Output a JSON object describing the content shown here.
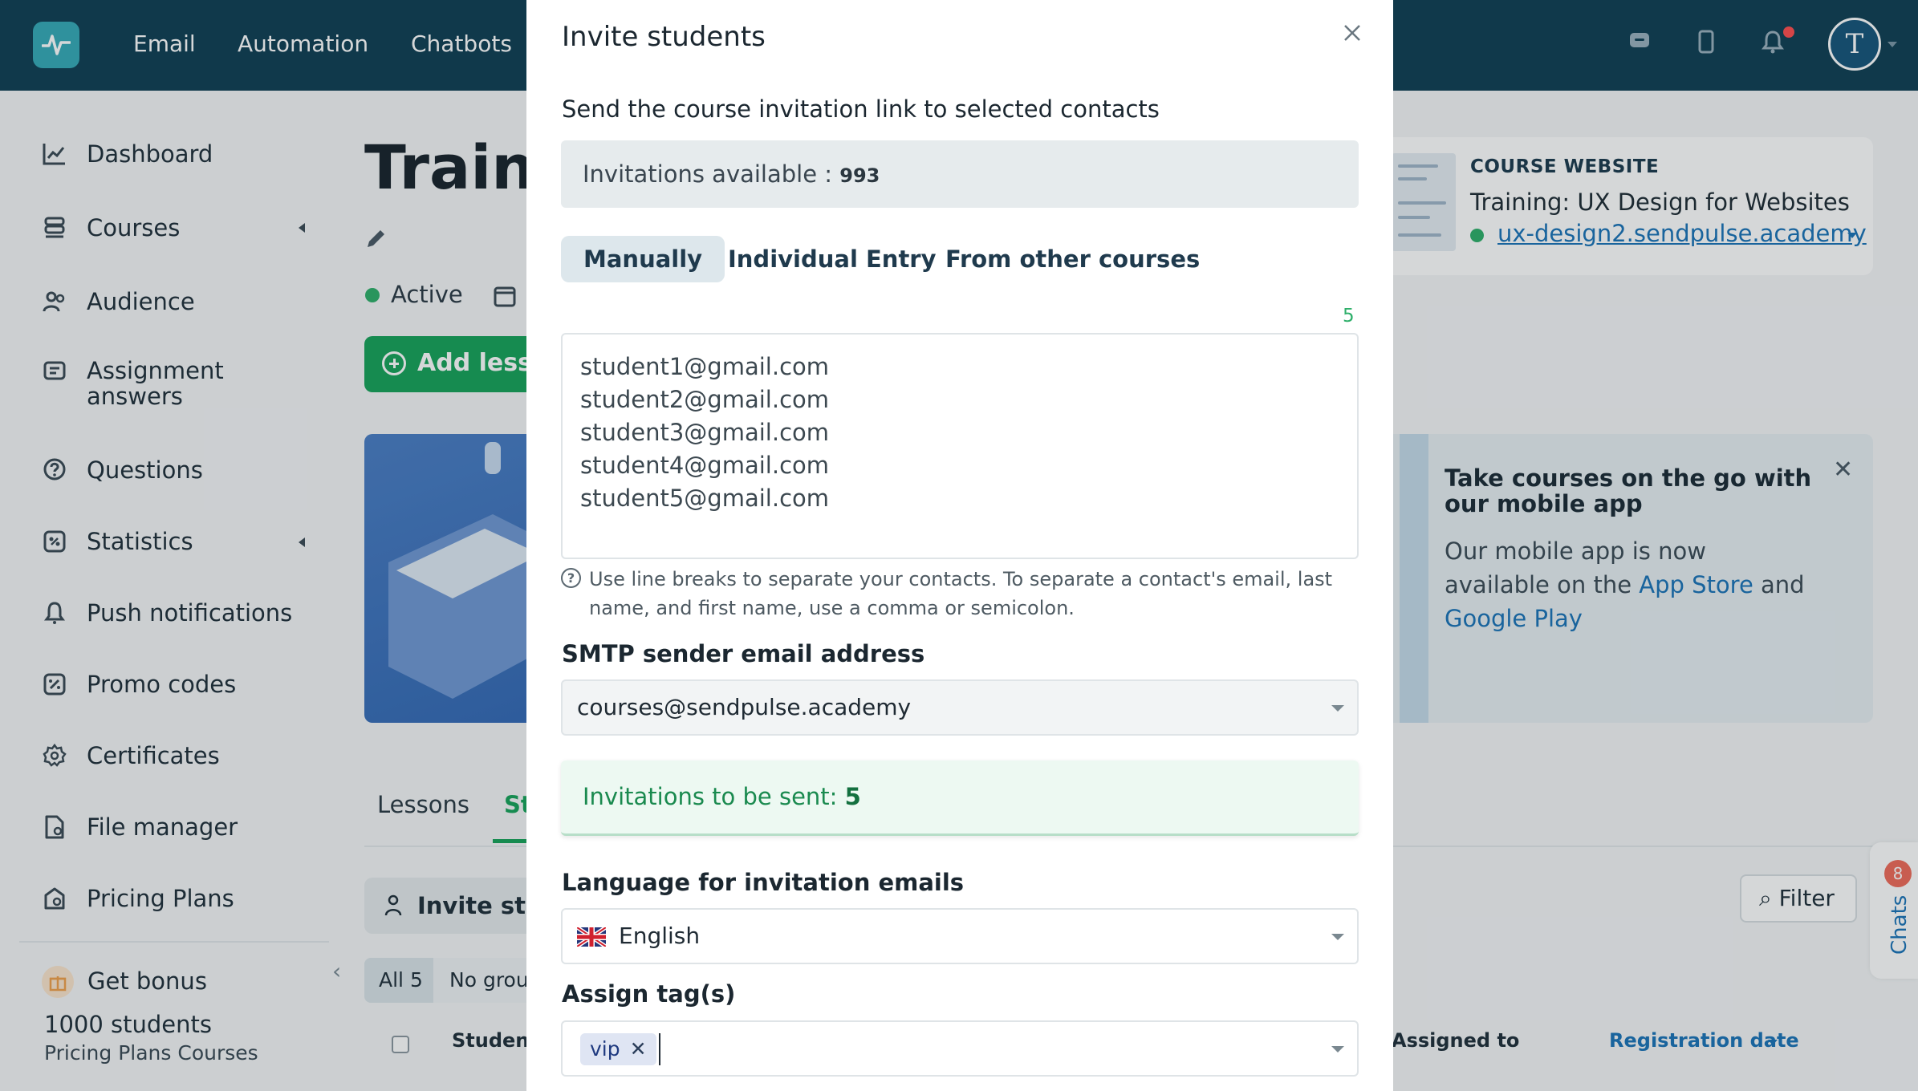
{
  "topnav": {
    "items": [
      "Email",
      "Automation",
      "Chatbots"
    ],
    "avatar_initial": "T"
  },
  "sidebar": {
    "items": [
      {
        "label": "Dashboard",
        "icon": "chart-line-icon"
      },
      {
        "label": "Courses",
        "icon": "courses-icon"
      },
      {
        "label": "Audience",
        "icon": "users-icon"
      },
      {
        "label": "Assignment answers",
        "icon": "assignment-icon"
      },
      {
        "label": "Questions",
        "icon": "question-icon"
      },
      {
        "label": "Statistics",
        "icon": "stats-icon"
      },
      {
        "label": "Push notifications",
        "icon": "bell-icon"
      },
      {
        "label": "Promo codes",
        "icon": "promo-icon"
      },
      {
        "label": "Certificates",
        "icon": "certificate-icon"
      },
      {
        "label": "File manager",
        "icon": "file-icon"
      },
      {
        "label": "Pricing Plans",
        "icon": "pricing-icon"
      }
    ],
    "bonus_label": "Get bonus",
    "plan_students": "1000 students",
    "plan_name": "Pricing Plans Courses"
  },
  "page": {
    "title": "Traini",
    "status": "Active",
    "add_lesson": "Add lesso",
    "tabs": [
      "Lessons",
      "St"
    ],
    "invite_button": "Invite stu",
    "filter_button": "Filter",
    "groups": {
      "all": "All 5",
      "no_group": "No grou"
    },
    "table_headers": {
      "student": "Student",
      "assigned": "Assigned to",
      "registration": "Registration date"
    }
  },
  "course_card": {
    "label": "COURSE WEBSITE",
    "title": "Training: UX Design for Websites",
    "link": "ux-design2.sendpulse.academy"
  },
  "mobile_promo": {
    "title": "Take courses on the go with our mobile app",
    "text_1": "Our mobile app is now available on the ",
    "app_store": "App Store",
    "text_2": " and ",
    "google_play": "Google Play"
  },
  "chats": {
    "label": "Chats",
    "count": "8"
  },
  "modal": {
    "title": "Invite students",
    "subtitle": "Send the course invitation link to selected contacts",
    "invitations_available_label": "Invitations available : ",
    "invitations_available_value": "993",
    "tabs": [
      "Manually",
      "Individual Entry",
      "From other courses"
    ],
    "contacts_count": "5",
    "contacts": [
      "student1@gmail.com",
      "student2@gmail.com",
      "student3@gmail.com",
      "student4@gmail.com",
      "student5@gmail.com"
    ],
    "help_text": "Use line breaks to separate your contacts. To separate a contact's email, last name, and first name, use a comma or semicolon.",
    "smtp_label": "SMTP sender email address",
    "smtp_value": "courses@sendpulse.academy",
    "to_be_sent_label": "Invitations to be sent: ",
    "to_be_sent_value": "5",
    "language_label": "Language for invitation emails",
    "language_value": "English",
    "tags_label": "Assign tag(s)",
    "tags": [
      "vip"
    ]
  },
  "colors": {
    "topbar": "#0f3f54",
    "accent_green": "#17a35a",
    "link_blue": "#1a73b8",
    "logo": "#35aab8"
  }
}
